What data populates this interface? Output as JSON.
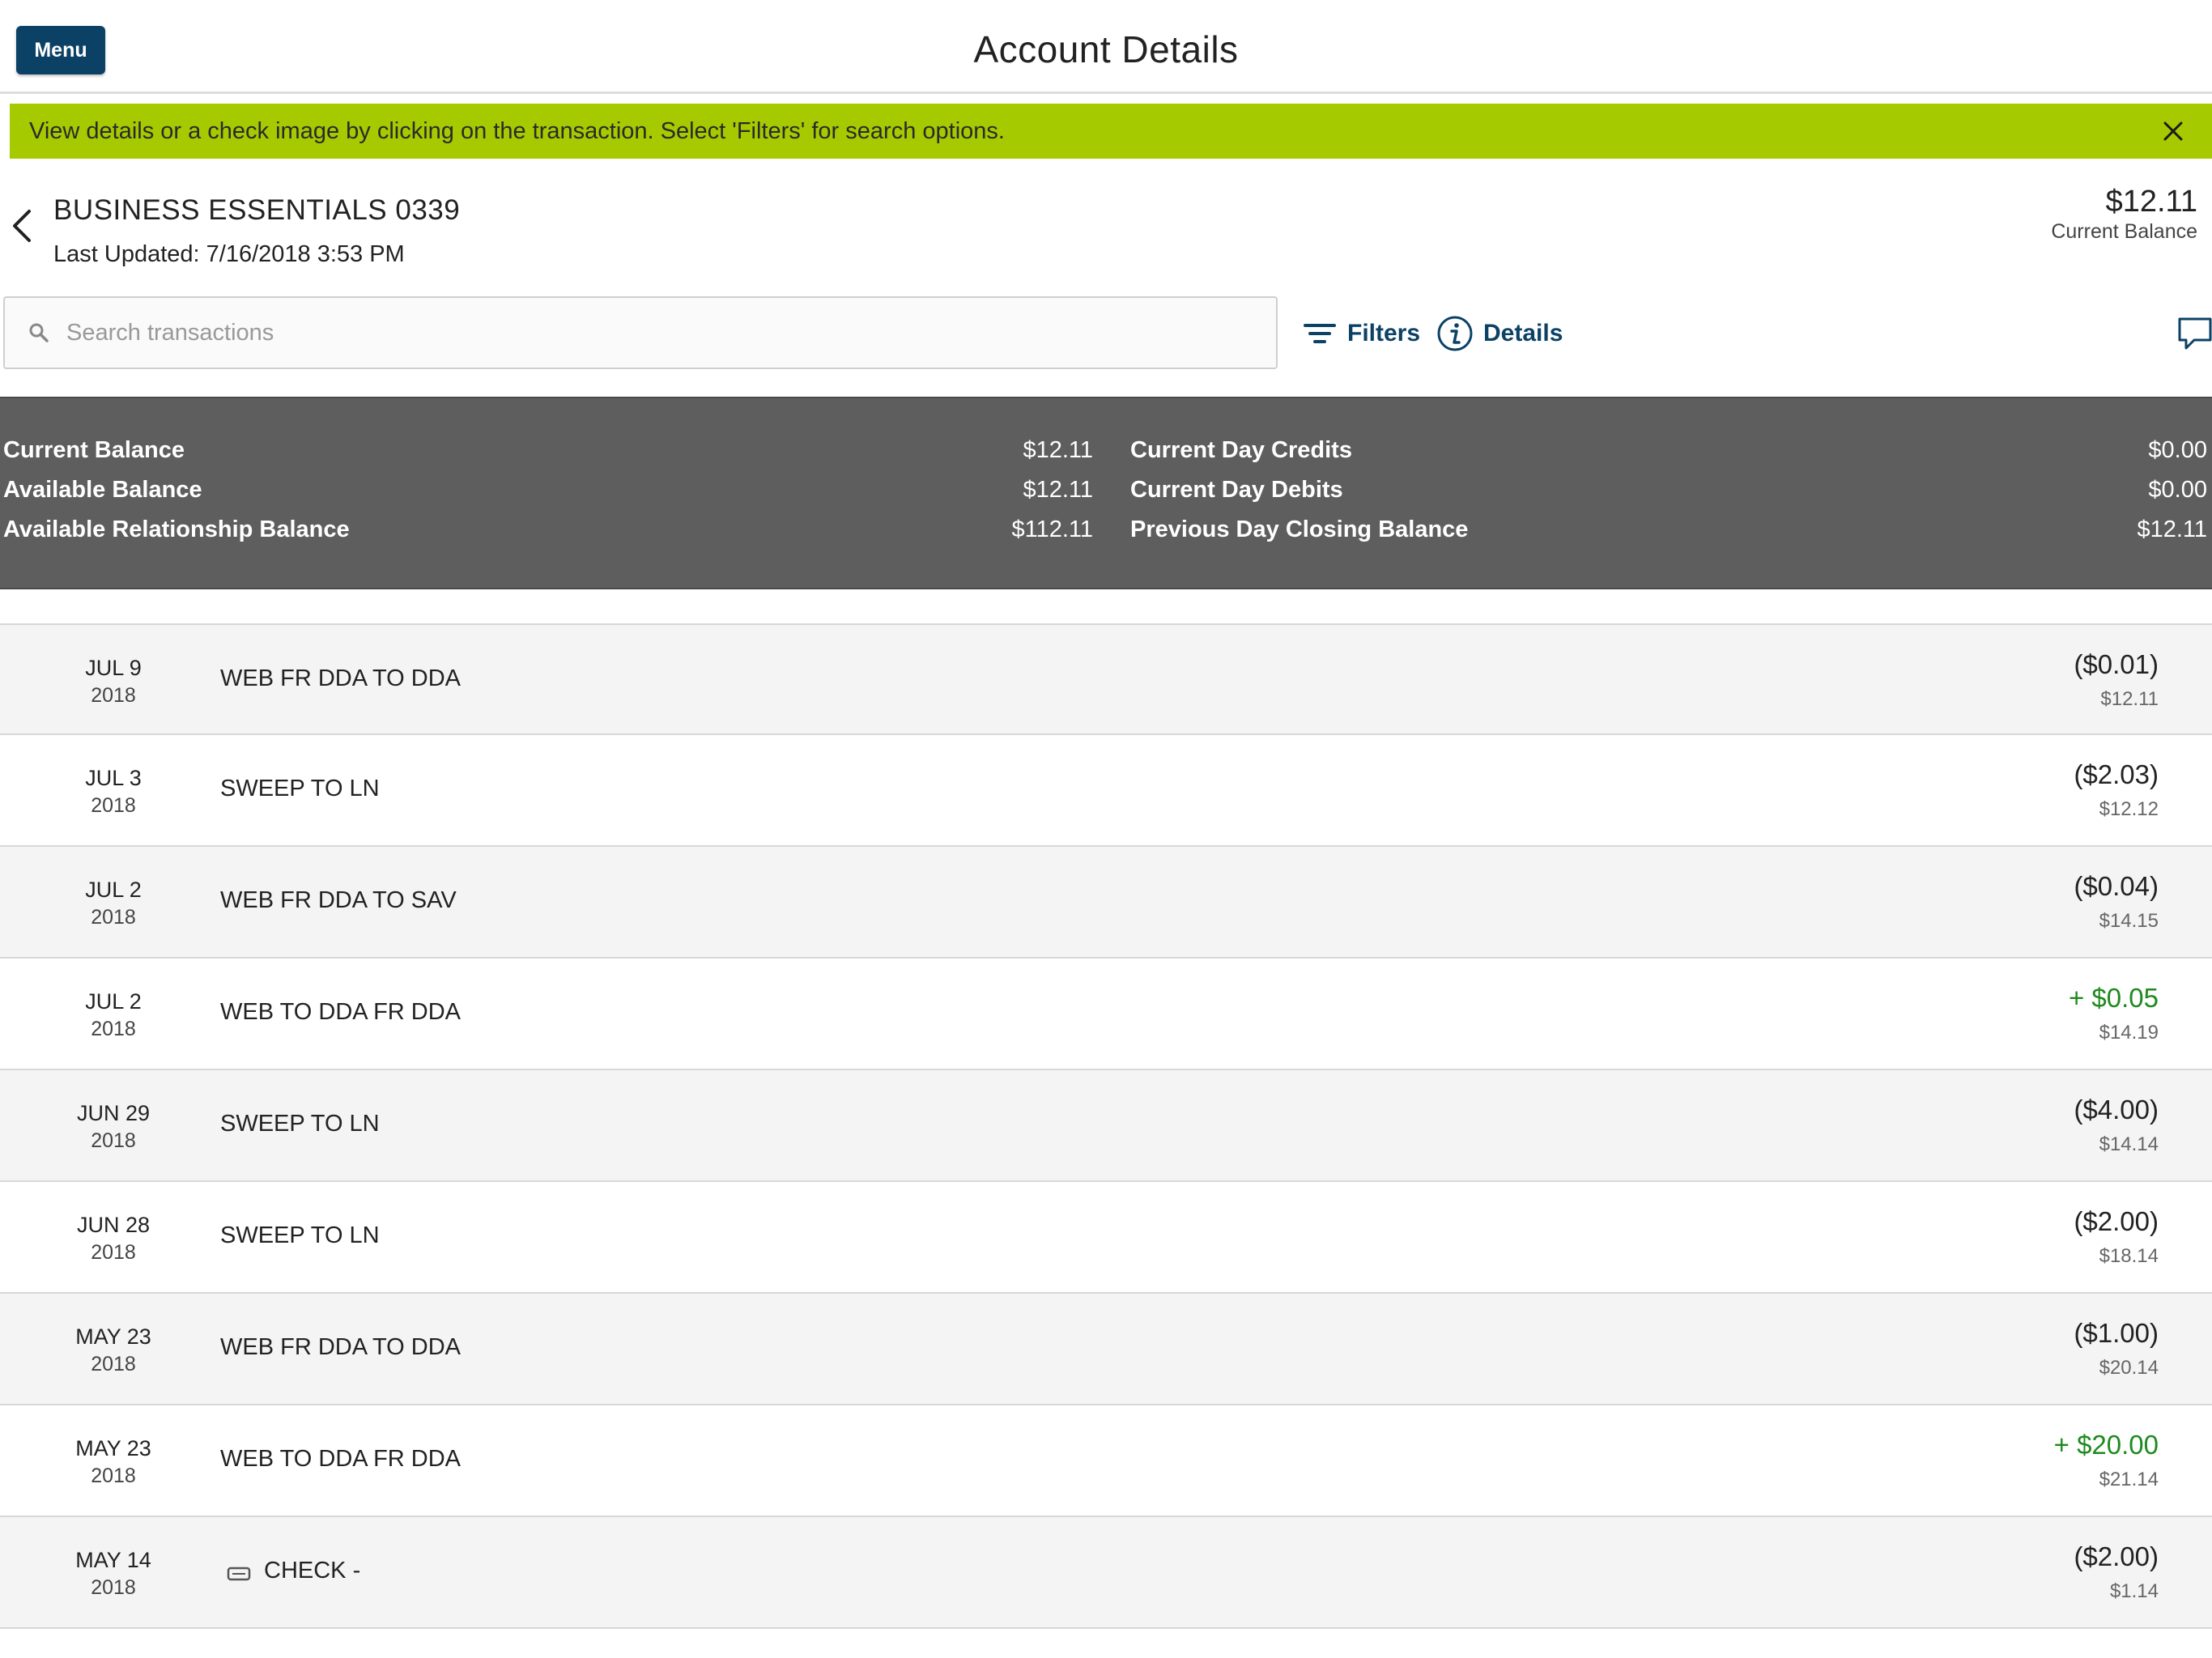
{
  "header": {
    "menu_label": "Menu",
    "title": "Account Details"
  },
  "banner": {
    "text": "View details or a check image by clicking on the transaction. Select 'Filters' for search options."
  },
  "account": {
    "name": "BUSINESS ESSENTIALS 0339",
    "last_updated": "Last Updated: 7/16/2018 3:53 PM",
    "balance": "$12.11",
    "balance_label": "Current Balance"
  },
  "search": {
    "placeholder": "Search transactions",
    "value": ""
  },
  "toolbar": {
    "filters_label": "Filters",
    "details_label": "Details"
  },
  "summary": {
    "left": [
      {
        "label": "Current Balance",
        "value": "$12.11"
      },
      {
        "label": "Available Balance",
        "value": "$12.11"
      },
      {
        "label": "Available Relationship Balance",
        "value": "$112.11"
      }
    ],
    "right": [
      {
        "label": "Current Day Credits",
        "value": "$0.00"
      },
      {
        "label": "Current Day Debits",
        "value": "$0.00"
      },
      {
        "label": "Previous Day Closing Balance",
        "value": "$12.11"
      }
    ]
  },
  "transactions": [
    {
      "date": "JUL 9",
      "year": "2018",
      "desc": "WEB FR DDA TO DDA",
      "amount": "($0.01)",
      "running": "$12.11"
    },
    {
      "date": "JUL 3",
      "year": "2018",
      "desc": "SWEEP TO LN",
      "amount": "($2.03)",
      "running": "$12.12"
    },
    {
      "date": "JUL 2",
      "year": "2018",
      "desc": "WEB FR DDA TO SAV",
      "amount": "($0.04)",
      "running": "$14.15"
    },
    {
      "date": "JUL 2",
      "year": "2018",
      "desc": "WEB TO DDA FR DDA",
      "amount": "+ $0.05",
      "running": "$14.19"
    },
    {
      "date": "JUN 29",
      "year": "2018",
      "desc": "SWEEP TO LN",
      "amount": "($4.00)",
      "running": "$14.14"
    },
    {
      "date": "JUN 28",
      "year": "2018",
      "desc": "SWEEP TO LN",
      "amount": "($2.00)",
      "running": "$18.14"
    },
    {
      "date": "MAY 23",
      "year": "2018",
      "desc": "WEB FR DDA TO DDA",
      "amount": "($1.00)",
      "running": "$20.14"
    },
    {
      "date": "MAY 23",
      "year": "2018",
      "desc": "WEB TO DDA FR DDA",
      "amount": "+ $20.00",
      "running": "$21.14"
    },
    {
      "date": "MAY 14",
      "year": "2018",
      "desc": "CHECK -",
      "amount": "($2.00)",
      "running": "$1.14"
    }
  ],
  "colors": {
    "brand": "#0c4166",
    "banner": "#a6ca00",
    "summary_bg": "#5e5e5e",
    "credit": "#1e8a1e"
  },
  "icons": {
    "back": "chevron-left-icon",
    "close": "close-icon",
    "search": "search-icon",
    "filters": "filter-lines-icon",
    "details": "info-circle-icon",
    "chat": "chat-bubble-icon",
    "check": "check-image-icon"
  }
}
